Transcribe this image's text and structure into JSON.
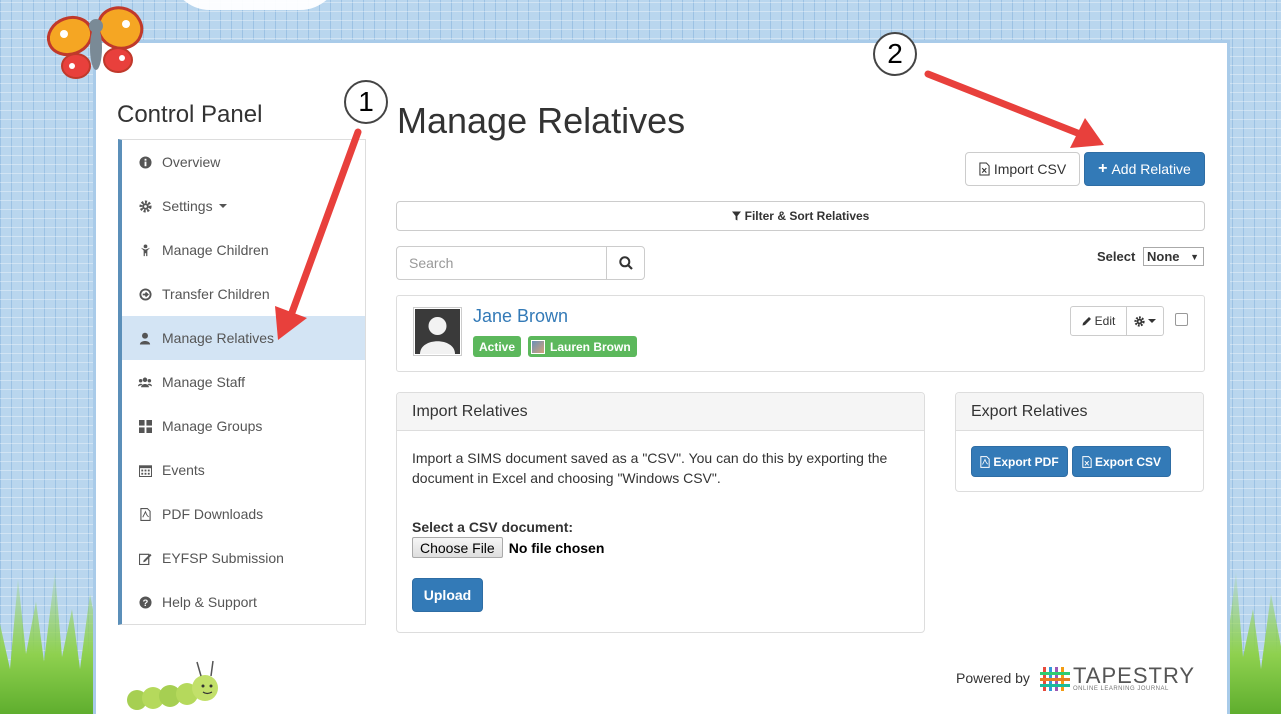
{
  "sidebar": {
    "title": "Control Panel",
    "items": [
      {
        "label": "Overview",
        "icon": "info-circle-icon"
      },
      {
        "label": "Settings",
        "icon": "gear-icon"
      },
      {
        "label": "Manage Children",
        "icon": "child-icon"
      },
      {
        "label": "Transfer Children",
        "icon": "arrow-circle-icon"
      },
      {
        "label": "Manage Relatives",
        "icon": "user-icon"
      },
      {
        "label": "Manage Staff",
        "icon": "users-icon"
      },
      {
        "label": "Manage Groups",
        "icon": "grid-icon"
      },
      {
        "label": "Events",
        "icon": "calendar-icon"
      },
      {
        "label": "PDF Downloads",
        "icon": "pdf-file-icon"
      },
      {
        "label": "EYFSP Submission",
        "icon": "edit-icon"
      },
      {
        "label": "Help & Support",
        "icon": "question-circle-icon"
      }
    ],
    "active_index": 4
  },
  "main": {
    "title": "Manage Relatives",
    "import_csv_label": "Import CSV",
    "add_relative_label": "Add Relative",
    "filter_label": "Filter & Sort Relatives",
    "search_placeholder": "Search",
    "select_label": "Select",
    "select_value": "None"
  },
  "relative": {
    "name": "Jane Brown",
    "status": "Active",
    "child": "Lauren Brown",
    "edit_label": "Edit"
  },
  "import_panel": {
    "heading": "Import Relatives",
    "text": "Import a SIMS document saved as a \"CSV\". You can do this by exporting the document in Excel and choosing \"Windows CSV\".",
    "csv_label": "Select a CSV document:",
    "choose_file": "Choose File",
    "no_file": "No file chosen",
    "upload": "Upload"
  },
  "export_panel": {
    "heading": "Export Relatives",
    "pdf": "Export PDF",
    "csv": "Export CSV"
  },
  "footer": {
    "powered_by": "Powered by",
    "brand": "TAPESTRY",
    "brand_sub": "ONLINE LEARNING JOURNAL"
  },
  "annotations": {
    "step1": "1",
    "step2": "2",
    "arrow_color": "#e8403c"
  },
  "colors": {
    "primary": "#337ab7",
    "success": "#5cb85c",
    "active_nav": "#d3e4f4"
  }
}
